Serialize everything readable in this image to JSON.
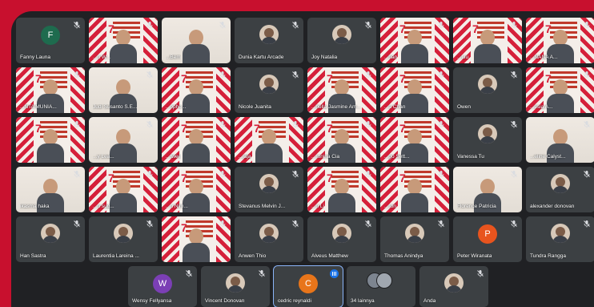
{
  "grid_tiles": [
    {
      "name": "Fanny Launa",
      "kind": "letter",
      "letter": "F",
      "color": "#1e6b4e"
    },
    {
      "name": "...n W...",
      "kind": "banner"
    },
    {
      "name": "...Bem",
      "kind": "video"
    },
    {
      "name": "Dunia Kartu Arcade",
      "kind": "photo"
    },
    {
      "name": "Joy Natalia",
      "kind": "photo"
    },
    {
      "name": "...han",
      "kind": "banner"
    },
    {
      "name": "...Liu",
      "kind": "banner"
    },
    {
      "name": "...NANA A...",
      "kind": "banner"
    },
    {
      "name": "...NTA MUNIA...",
      "kind": "banner"
    },
    {
      "name": "Judi Susanto S.E...",
      "kind": "video"
    },
    {
      "name": "...ophe...",
      "kind": "banner"
    },
    {
      "name": "Nicole Juanita",
      "kind": "photo"
    },
    {
      "name": "...hella Jasmine Am...",
      "kind": "banner"
    },
    {
      "name": "...a Chan",
      "kind": "banner"
    },
    {
      "name": "Owen",
      "kind": "photo"
    },
    {
      "name": "...esia A...",
      "kind": "banner"
    },
    {
      "name": "",
      "kind": "banner"
    },
    {
      "name": "...y Lea...",
      "kind": "video"
    },
    {
      "name": "...twee",
      "kind": "banner"
    },
    {
      "name": "...jaja",
      "kind": "banner"
    },
    {
      "name": "...ronina Cia",
      "kind": "banner"
    },
    {
      "name": "...go Sett...",
      "kind": "banner"
    },
    {
      "name": "Vanessa Tu",
      "kind": "photo"
    },
    {
      "name": "...eline Calyst...",
      "kind": "video"
    },
    {
      "name": "ikasma haka",
      "kind": "video"
    },
    {
      "name": "...n sug...",
      "kind": "banner"
    },
    {
      "name": "...n Nim...",
      "kind": "banner"
    },
    {
      "name": "Stevanus Melvin J...",
      "kind": "photo"
    },
    {
      "name": "...n Li",
      "kind": "banner"
    },
    {
      "name": "...ron",
      "kind": "banner"
    },
    {
      "name": "Florence Patricia",
      "kind": "video"
    },
    {
      "name": "alexander donovan",
      "kind": "photo"
    },
    {
      "name": "Han Sastra",
      "kind": "photo"
    },
    {
      "name": "Laurentia Lareina ...",
      "kind": "photo"
    },
    {
      "name": "",
      "kind": "banner"
    },
    {
      "name": "Anwen Thio",
      "kind": "photo"
    },
    {
      "name": "Alveus Matthew",
      "kind": "photo"
    },
    {
      "name": "Thomas Anindya",
      "kind": "photo"
    },
    {
      "name": "Peter Wiranata",
      "kind": "letter",
      "letter": "P",
      "color": "#e8541e"
    },
    {
      "name": "Tundra Rangga",
      "kind": "photo"
    }
  ],
  "bottom_tiles": [
    {
      "name": "Wensy Fellyansa",
      "kind": "letter",
      "letter": "W",
      "color": "#7b3fb5"
    },
    {
      "name": "Vincent Donovan",
      "kind": "photo"
    },
    {
      "name": "cedric reynaldi",
      "kind": "letter",
      "letter": "C",
      "color": "#e8751a",
      "selected": true
    },
    {
      "name": "34 lainnya",
      "kind": "more"
    },
    {
      "name": "Anda",
      "kind": "photo"
    }
  ],
  "colors": {
    "frame": "#c8102e",
    "background": "#202124",
    "tile": "#3c4043",
    "accent": "#1a73e8"
  }
}
